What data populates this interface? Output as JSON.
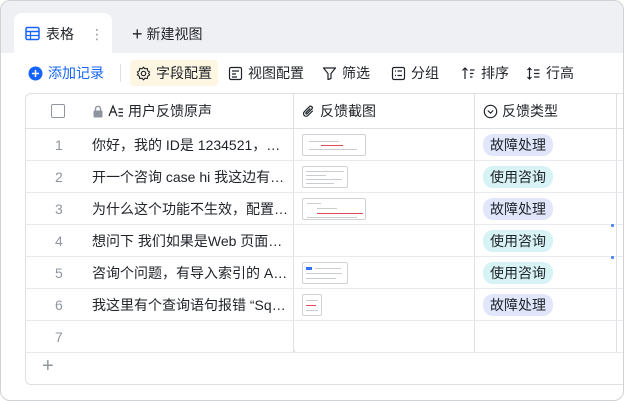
{
  "tabs": {
    "active_label": "表格",
    "new_view_label": "新建视图"
  },
  "toolbar": {
    "add_record": "添加记录",
    "field_config": "字段配置",
    "view_config": "视图配置",
    "filter": "筛选",
    "group": "分组",
    "sort": "排序",
    "row_height": "行高"
  },
  "columns": {
    "feedback_text": "用户反馈原声",
    "screenshot": "反馈截图",
    "feedback_type": "反馈类型"
  },
  "colors": {
    "accent": "#1664ff",
    "badge_fault_bg": "#e1e6fb",
    "badge_consult_bg": "#d8f3f5"
  },
  "rows": [
    {
      "index": "1",
      "text": "你好，我的 ID是 1234521，…",
      "screenshot_icon": "image-thumbnail",
      "type": "故障处理",
      "type_kind": "fault"
    },
    {
      "index": "2",
      "text": "开一个咨询 case hi 我这边有…",
      "screenshot_icon": "image-thumbnail",
      "type": "使用咨询",
      "type_kind": "consult"
    },
    {
      "index": "3",
      "text": "为什么这个功能不生效，配置…",
      "screenshot_icon": "image-thumbnail",
      "type": "故障处理",
      "type_kind": "fault"
    },
    {
      "index": "4",
      "text": "想问下 我们如果是Web 页面…",
      "screenshot_icon": "",
      "type": "使用咨询",
      "type_kind": "consult"
    },
    {
      "index": "5",
      "text": "咨询个问题，有导入索引的 A…",
      "screenshot_icon": "image-thumbnail",
      "type": "使用咨询",
      "type_kind": "consult"
    },
    {
      "index": "6",
      "text": "我这里有个查询语句报错 “Sql…",
      "screenshot_icon": "image-thumbnail",
      "type": "故障处理",
      "type_kind": "fault"
    },
    {
      "index": "7",
      "text": "",
      "screenshot_icon": "",
      "type": "",
      "type_kind": ""
    }
  ]
}
